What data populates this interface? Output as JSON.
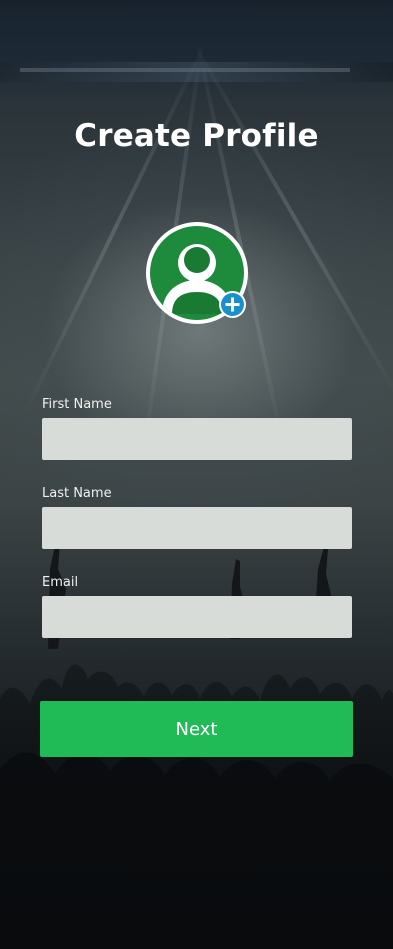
{
  "page": {
    "title": "Create Profile"
  },
  "avatar": {
    "icon": "user-avatar-icon",
    "add_icon": "add-photo-icon",
    "accent": "#1e8a3c",
    "badge_color": "#1b8fce"
  },
  "form": {
    "first_name": {
      "label": "First Name",
      "value": "",
      "placeholder": ""
    },
    "last_name": {
      "label": "Last Name",
      "value": "",
      "placeholder": ""
    },
    "email": {
      "label": "Email",
      "value": "",
      "placeholder": ""
    }
  },
  "actions": {
    "next_label": "Next",
    "next_color": "#20bb57"
  }
}
